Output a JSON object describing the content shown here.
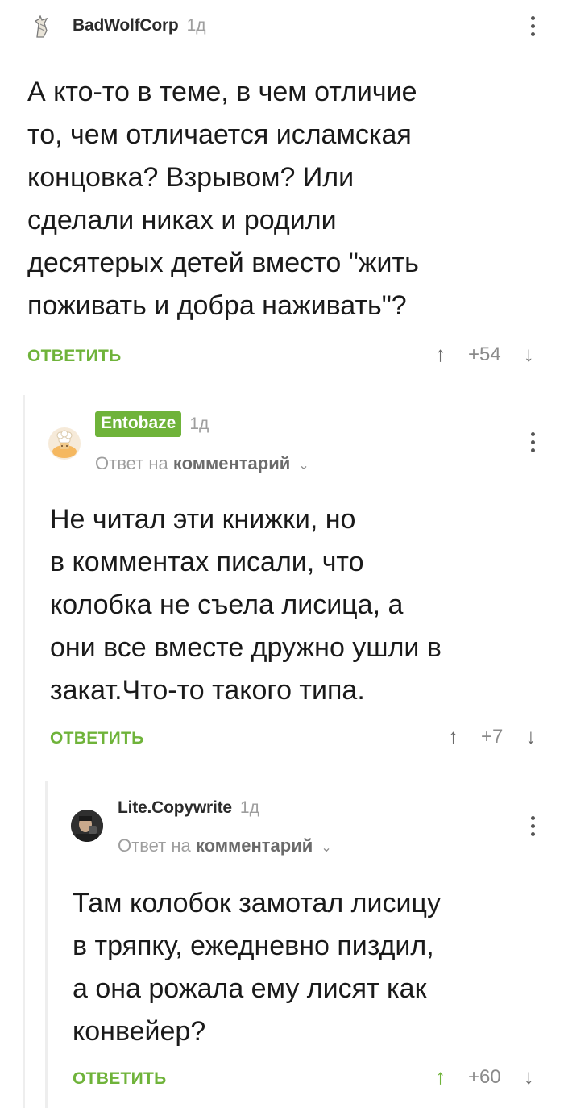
{
  "comments": [
    {
      "author": "BadWolfCorp",
      "time": "1д",
      "text": "А кто-то в теме, в чем отличие\nто, чем отличается исламская\nконцовка? Взрывом? Или\nсделали никах и родили\nдесятерых детей вместо \"жить\nпоживать и добра наживать\"?",
      "reply_label": "ОТВЕТИТЬ",
      "up_icon": "↑",
      "score": "+54",
      "down_icon": "↓"
    },
    {
      "author": "Entobaze",
      "time": "1д",
      "reply_prefix": "Ответ на",
      "reply_target": "комментарий",
      "chevron": "⌄",
      "text": "Не читал эти книжки, но\nв комментах писали, что\nколобка не съела лисица, а\nони все вместе дружно ушли в\nзакат.Что-то такого типа.",
      "reply_label": "ОТВЕТИТЬ",
      "up_icon": "↑",
      "score": "+7",
      "down_icon": "↓"
    },
    {
      "author": "Lite.Copywrite",
      "time": "1д",
      "reply_prefix": "Ответ на",
      "reply_target": "комментарий",
      "chevron": "⌄",
      "text": "Там колобок замотал лисицу\nв тряпку, ежедневно пиздил,\nа она рожала ему лисят как\nконвейер?",
      "reply_label": "ОТВЕТИТЬ",
      "up_icon": "↑",
      "score": "+60",
      "down_icon": "↓"
    }
  ],
  "colors": {
    "accent": "#6fb33a",
    "muted": "#9e9e9e",
    "thread_line": "#eeeeee"
  },
  "icons": [
    "wolf-avatar-icon",
    "more-vertical-icon",
    "arrow-up-icon",
    "arrow-down-icon",
    "chevron-down-icon"
  ]
}
